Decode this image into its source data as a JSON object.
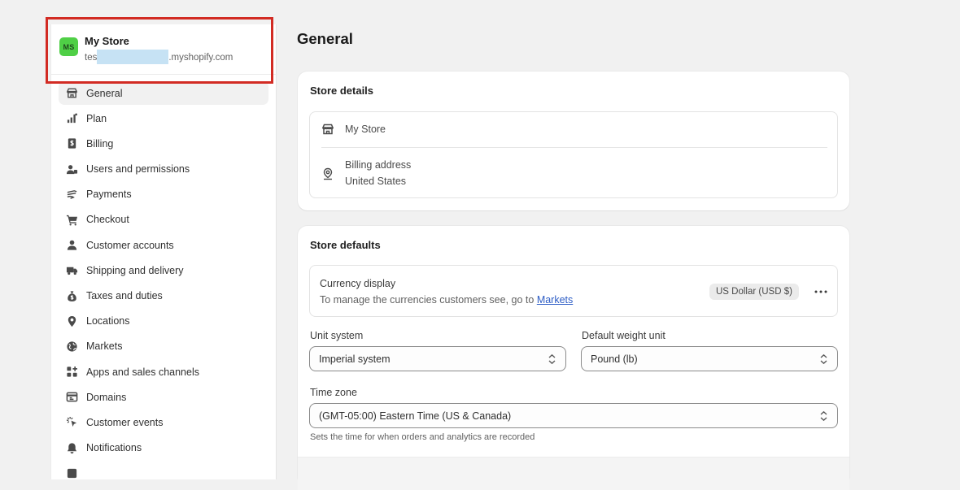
{
  "store": {
    "name": "My Store",
    "initials": "MS",
    "domain_prefix": "tes",
    "domain_suffix": ".myshopify.com"
  },
  "sidebar": {
    "items": [
      {
        "label": "General",
        "icon": "store-icon",
        "active": true
      },
      {
        "label": "Plan",
        "icon": "chart-bars-icon"
      },
      {
        "label": "Billing",
        "icon": "dollar-receipt-icon"
      },
      {
        "label": "Users and permissions",
        "icon": "users-icon"
      },
      {
        "label": "Payments",
        "icon": "payment-hand-icon"
      },
      {
        "label": "Checkout",
        "icon": "cart-icon"
      },
      {
        "label": "Customer accounts",
        "icon": "person-icon"
      },
      {
        "label": "Shipping and delivery",
        "icon": "truck-icon"
      },
      {
        "label": "Taxes and duties",
        "icon": "money-bag-icon"
      },
      {
        "label": "Locations",
        "icon": "location-pin-icon"
      },
      {
        "label": "Markets",
        "icon": "globe-icon"
      },
      {
        "label": "Apps and sales channels",
        "icon": "apps-grid-icon"
      },
      {
        "label": "Domains",
        "icon": "browser-window-icon"
      },
      {
        "label": "Customer events",
        "icon": "cursor-sparkle-icon"
      },
      {
        "label": "Notifications",
        "icon": "bell-icon"
      },
      {
        "label": "",
        "icon": "partial-icon"
      }
    ]
  },
  "main": {
    "title": "General",
    "store_details": {
      "title": "Store details",
      "store_name": "My Store",
      "billing_label": "Billing address",
      "billing_country": "United States"
    },
    "store_defaults": {
      "title": "Store defaults",
      "currency": {
        "title": "Currency display",
        "description": "To manage the currencies customers see, go to ",
        "link": "Markets",
        "badge": "US Dollar (USD $)",
        "more": "•••"
      },
      "unit_system": {
        "label": "Unit system",
        "value": "Imperial system"
      },
      "weight_unit": {
        "label": "Default weight unit",
        "value": "Pound (lb)"
      },
      "time_zone": {
        "label": "Time zone",
        "value": "(GMT-05:00) Eastern Time (US & Canada)",
        "help": "Sets the time for when orders and analytics are recorded"
      }
    }
  }
}
